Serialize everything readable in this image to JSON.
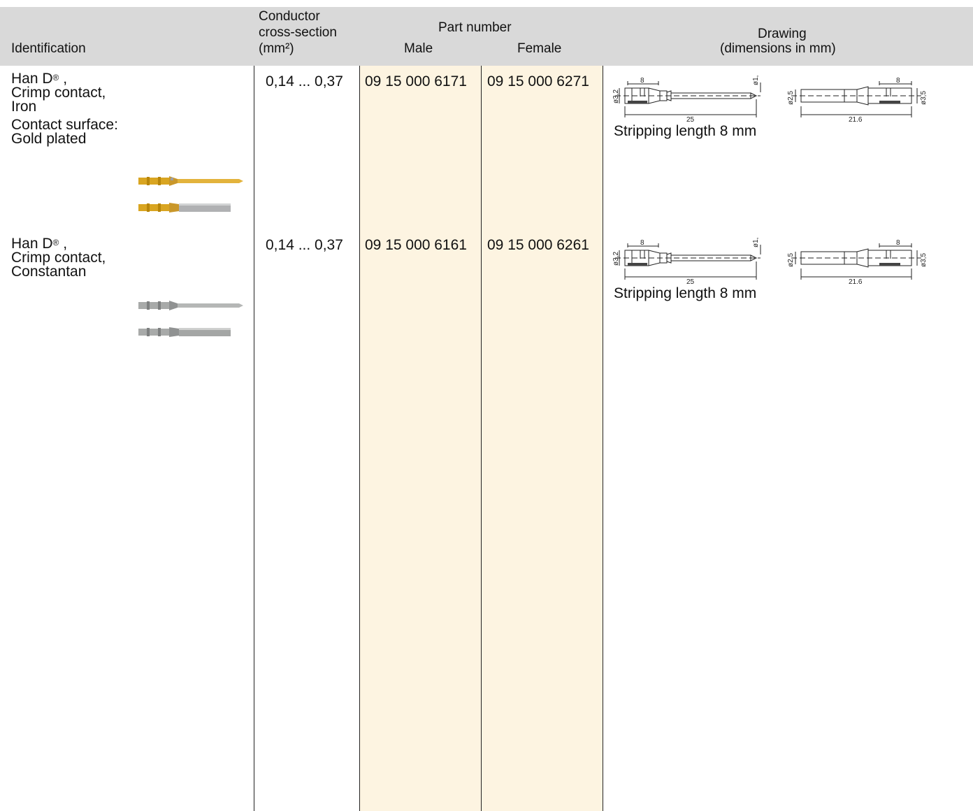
{
  "header": {
    "identification": "Identification",
    "conductor_line1": "Conductor",
    "conductor_line2": "cross-section",
    "conductor_line3": "(mm²)",
    "part_number": "Part number",
    "male": "Male",
    "female": "Female",
    "drawing_line1": "Drawing",
    "drawing_line2": "(dimensions in mm)"
  },
  "colors": {
    "header_bg": "#d9d9d9",
    "part_number_highlight": "#fdf4e1",
    "gold_contact": "#d9a521",
    "silver_contact": "#a8aaa9"
  },
  "rows": [
    {
      "name_prefix": "Han D",
      "name_reg": "®",
      "name_suffix": " ,",
      "line2": "Crimp contact,",
      "line3": "Iron",
      "surface_label": "Contact surface:",
      "surface_value": "Gold plated",
      "cross_section": "0,14 ... 0,37",
      "male": "09 15 000 6171",
      "female": "09 15 000 6271",
      "stripping": "Stripping length 8 mm",
      "dims_male": {
        "d_left": "ø3,2",
        "top": "8",
        "d_right": "ø1,6",
        "length": "25"
      },
      "dims_female": {
        "d_left": "ø2,5",
        "top": "8",
        "d_right": "ø3,5",
        "length": "21,6"
      }
    },
    {
      "name_prefix": "Han D",
      "name_reg": "®",
      "name_suffix": " ,",
      "line2": "Crimp contact,",
      "line3": "Constantan",
      "cross_section": "0,14 ... 0,37",
      "male": "09 15 000 6161",
      "female": "09 15 000 6261",
      "stripping": "Stripping length 8 mm",
      "dims_male": {
        "d_left": "ø3,2",
        "top": "8",
        "d_right": "ø1,6",
        "length": "25"
      },
      "dims_female": {
        "d_left": "ø2,5",
        "top": "8",
        "d_right": "ø3,5",
        "length": "21,6"
      }
    }
  ]
}
